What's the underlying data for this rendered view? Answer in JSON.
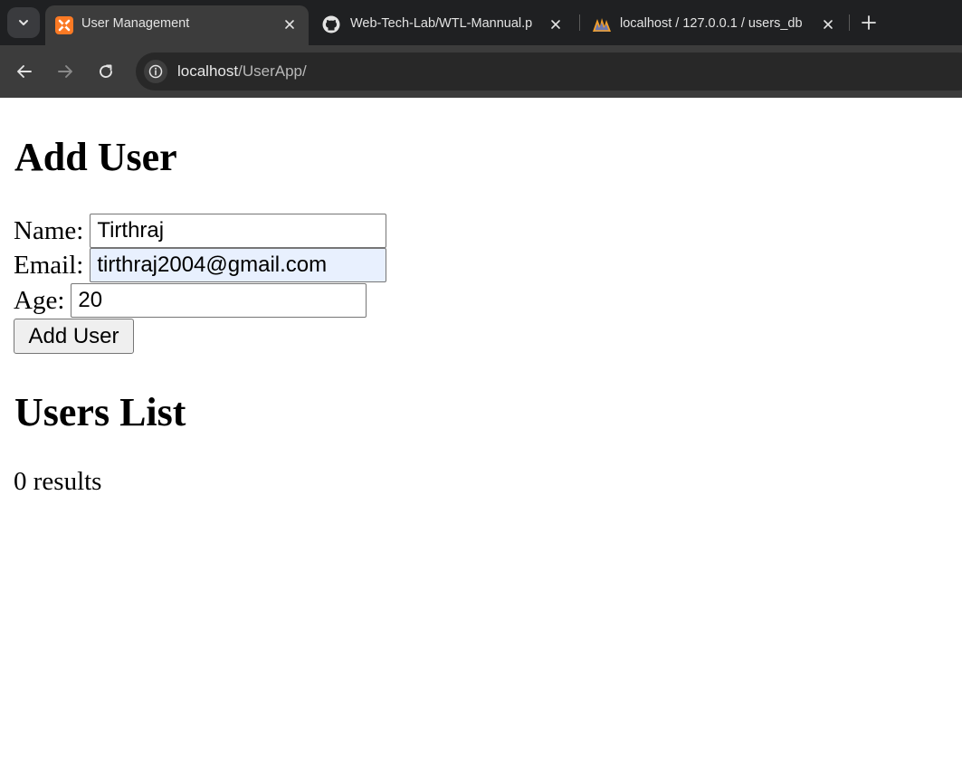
{
  "browser": {
    "tabs": [
      {
        "title": "User Management",
        "icon": "xampp-icon",
        "active": true
      },
      {
        "title": "Web-Tech-Lab/WTL-Mannual.p",
        "icon": "github-icon",
        "active": false
      },
      {
        "title": "localhost / 127.0.0.1 / users_db",
        "icon": "phpmyadmin-icon",
        "active": false
      }
    ],
    "url_host": "localhost",
    "url_path": "/UserApp/",
    "colors": {
      "tabbar": "#1f2022",
      "active_tab": "#3c3c3c",
      "xampp_orange": "#fb7a24"
    }
  },
  "form": {
    "heading": "Add User",
    "name_label": "Name:",
    "name_value": "Tirthraj",
    "email_label": "Email:",
    "email_value": "tirthraj2004@gmail.com",
    "age_label": "Age:",
    "age_value": "20",
    "submit_label": "Add User"
  },
  "list": {
    "heading": "Users List",
    "results_text": "0 results"
  }
}
